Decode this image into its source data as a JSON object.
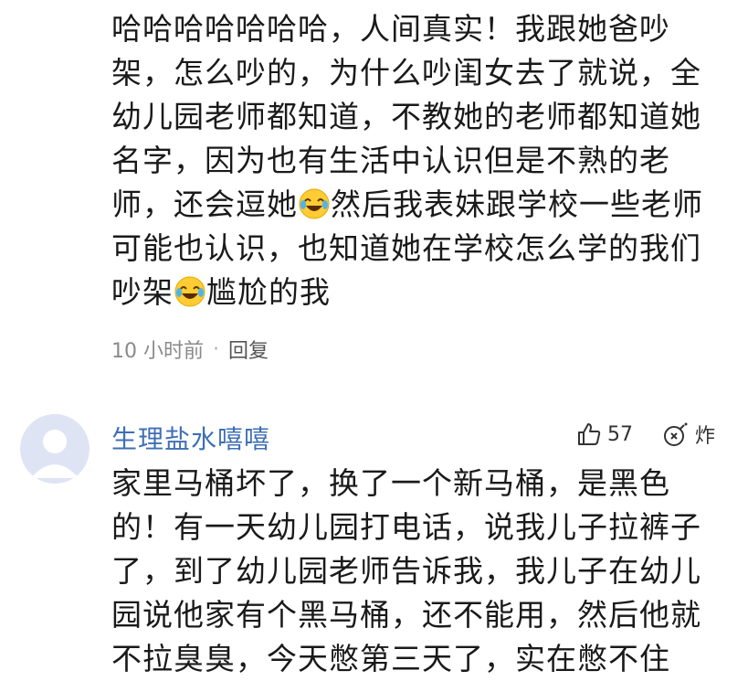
{
  "comment_1": {
    "text_part1": "哈哈哈哈哈哈哈，人间真实！我跟她爸吵架，怎么吵的，为什么吵闺女去了就说，全幼儿园老师都知道，不教她的老师都知道她名字，因为也有生活中认识但是不熟的老师，还会逗她",
    "emoji_1": "laughing-tears-emoji",
    "text_part2": "然后我表妹跟学校一些老师可能也认识，也知道她在学校怎么学的我们吵架",
    "emoji_2": "laughing-tears-emoji",
    "text_part3": "尴尬的我",
    "time": "10 小时前",
    "separator": "·",
    "reply_label": "回复"
  },
  "comment_2": {
    "avatar_icon": "default-avatar-icon",
    "username": "生理盐水嘻嘻",
    "like_icon": "thumbs-up-icon",
    "like_count": "57",
    "bomb_icon": "bomb-icon",
    "bomb_label": "炸",
    "text": "家里马桶坏了，换了一个新马桶，是黑色的！有一天幼儿园打电话，说我儿子拉裤子了，到了幼儿园老师告诉我，我儿子在幼儿园说他家有个黑马桶，还不能用，然后他就不拉臭臭，今天憋第三天了，实在憋不住"
  },
  "colors": {
    "username": "#3f6fb5",
    "meta": "#8a8a8a",
    "avatar_bg": "#dfe4f5"
  }
}
